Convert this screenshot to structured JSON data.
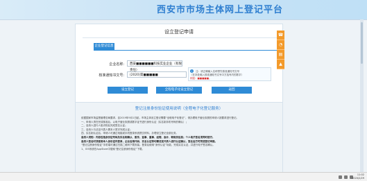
{
  "site": {
    "title": "西安市市场主体网上登记平台"
  },
  "card": {
    "title": "设立登记申请",
    "tab_label": "企业登记信息"
  },
  "form": {
    "company_name_label": "企业名称:",
    "company_name_value": "西安■■■■■■科技实业企业（有限责任）",
    "credit_code_label": "核准通知书文号:",
    "credit_code_value": "(2020)第■■■■■"
  },
  "hint": {
    "line1": "注：请正确输入名称预先核准通知书文号",
    "line2": "（在本处输入核准通知书文号中方括号内的数字）",
    "highlight": "例如：■■■■■。"
  },
  "buttons": {
    "setup": "设立登记",
    "eform": "全程电子化设立登记",
    "back": "返回"
  },
  "notice": {
    "title": "登记注册身份验证使用说明（全程电子化登记服务）",
    "lines": [
      "依据国家市场监督管理总局要求，自2019年9月1日起，市场主体设立登记需要“全程电子化登记”，请办理电子营业执照的申请人按要求进行登记。",
      "一、申请人须在完成核准后，以电子营业执照或数字证书进行身份认证（实名制手机号码的确认）；",
      "二、自然人进行人脸识别后完成签名认证；",
      "三、自然人与法定代表人需本人签字完成认证；",
      "四、实名制认证后，申请人可通过电脑或手机登录系统提交材料，办理设立登记全部业务。",
      "自然人须知：内容包括身份证号码及实名制确认、股东、监事、董事、经理、会计、联络员信息；个人电子签名须同时进行，",
      "自然人签名时须使用本人身份证件登录，企业信用代码、实名认证等均需法定代表人进行认证确认，签名后方可完成登记申报。",
      "“登记注册身份验证”手机端可通过扫描二维码下载安装，登录后使用“身份认证”功能，完成实名认证，并进行电子签名确认。",
      "1、IOS系统在AppStore中搜索“登记注册身份验证”下载。"
    ]
  },
  "side_toolbar": {
    "items": [
      "phone-icon",
      "qq-icon",
      "document-icon",
      "arrow-up-icon"
    ]
  },
  "taskbar": {
    "time": "11:02",
    "date": "2020/2/29"
  }
}
